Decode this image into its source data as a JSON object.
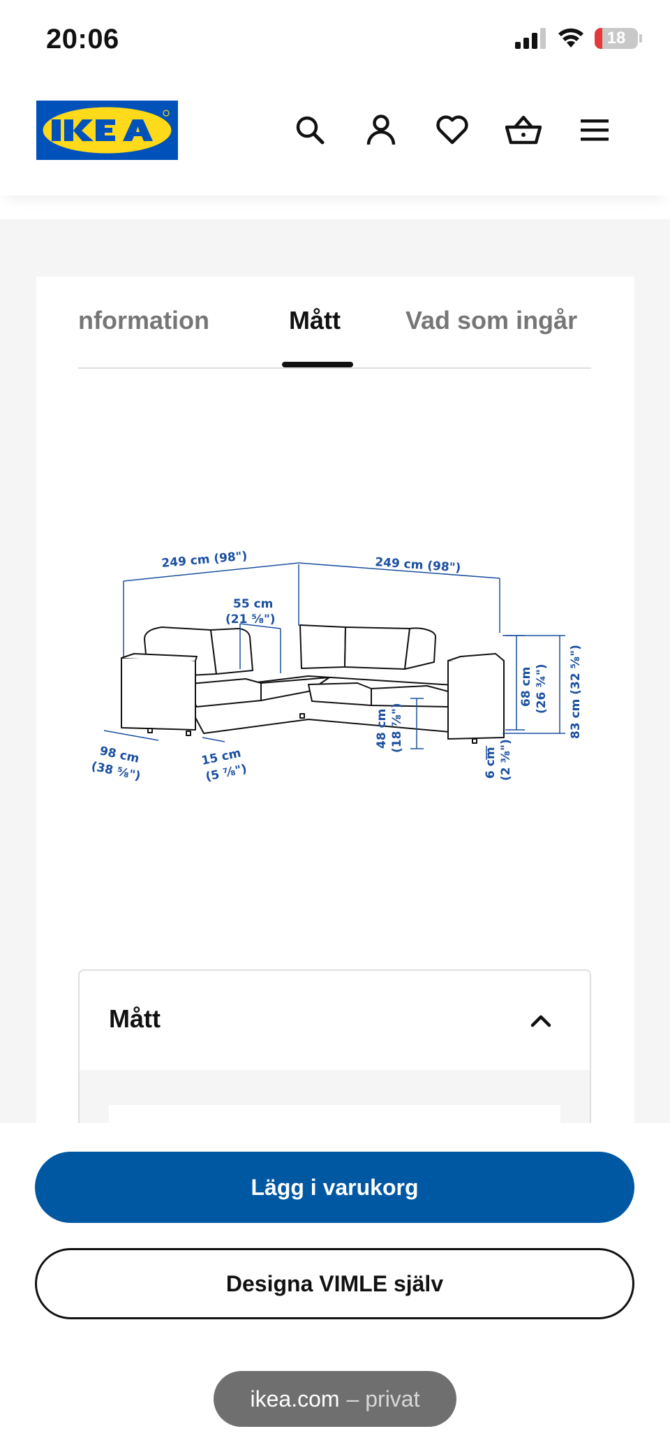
{
  "status_bar": {
    "time": "20:06",
    "battery_level": "18",
    "battery_fraction": 0.18
  },
  "header": {
    "logo_text": "IKEA",
    "icons": [
      "search-icon",
      "account-icon",
      "heart-icon",
      "basket-icon",
      "menu-icon"
    ]
  },
  "tabs": [
    {
      "label": "Produktinformation",
      "visible_label": "information",
      "active": false
    },
    {
      "label": "Mått",
      "active": true
    },
    {
      "label": "Vad som ingår",
      "active": false
    }
  ],
  "diagram": {
    "width_left": "249 cm (98\")",
    "width_right": "249 cm (98\")",
    "seat_depth_line1": "55 cm",
    "seat_depth_line2": "(21 ⅝\")",
    "depth_line1": "98 cm",
    "depth_line2": "(38 ⅝\")",
    "leg_offset_line1": "15 cm",
    "leg_offset_line2": "(5 ⅞\")",
    "seat_height_line1": "48 cm",
    "seat_height_line2": "(18 ⅞\")",
    "leg_height_line1": "6 cm",
    "leg_height_line2": "(2 ⅜\")",
    "arm_height_line1": "68 cm",
    "arm_height_line2": "(26 ¾\")",
    "total_height": "83 cm (32 ⅝\")"
  },
  "accordion": {
    "title": "Mått",
    "expanded": true
  },
  "buttons": {
    "add_to_cart": "Lägg i varukorg",
    "design_yourself": "Designa VIMLE själv"
  },
  "url_bar": {
    "domain": "ikea.com",
    "suffix": "– privat"
  },
  "colors": {
    "ikea_blue": "#0058a3",
    "logo_blue": "#0051ba",
    "logo_yellow": "#ffda1a",
    "dimension_blue": "#1a4fa0"
  }
}
